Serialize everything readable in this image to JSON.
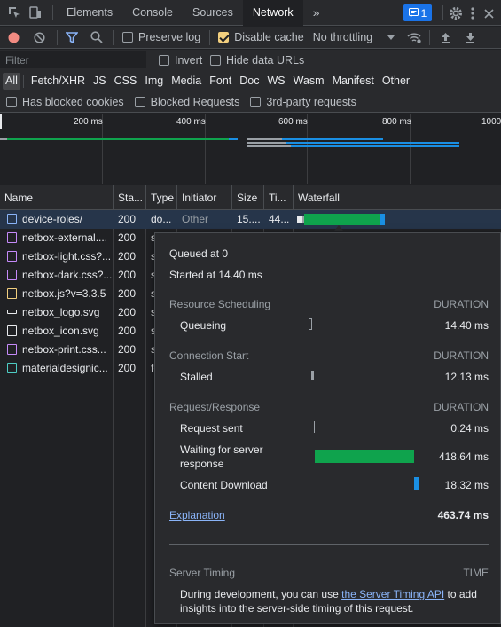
{
  "tabs": {
    "items": [
      "Elements",
      "Console",
      "Sources",
      "Network"
    ],
    "more": "»",
    "issues_count": "1"
  },
  "toolbar": {
    "preserve_log": "Preserve log",
    "disable_cache": "Disable cache",
    "throttling": "No throttling"
  },
  "filter": {
    "placeholder": "Filter",
    "invert": "Invert",
    "hide_data_urls": "Hide data URLs"
  },
  "types": [
    "All",
    "Fetch/XHR",
    "JS",
    "CSS",
    "Img",
    "Media",
    "Font",
    "Doc",
    "WS",
    "Wasm",
    "Manifest",
    "Other"
  ],
  "options": {
    "blocked_cookies": "Has blocked cookies",
    "blocked_requests": "Blocked Requests",
    "third_party": "3rd-party requests"
  },
  "overview": {
    "ticks": [
      "200 ms",
      "400 ms",
      "600 ms",
      "800 ms",
      "1000"
    ]
  },
  "table": {
    "headers": [
      "Name",
      "Sta...",
      "Type",
      "Initiator",
      "Size",
      "Ti...",
      "Waterfall"
    ],
    "rows": [
      {
        "name": "device-roles/",
        "status": "200",
        "type": "do...",
        "initiator": "Other",
        "size": "15....",
        "time": "44...",
        "kind": "doc"
      },
      {
        "name": "netbox-external....",
        "status": "200",
        "type": "s",
        "initiator": "",
        "size": "",
        "time": "",
        "kind": "css"
      },
      {
        "name": "netbox-light.css?...",
        "status": "200",
        "type": "s",
        "initiator": "",
        "size": "",
        "time": "",
        "kind": "css"
      },
      {
        "name": "netbox-dark.css?...",
        "status": "200",
        "type": "s",
        "initiator": "",
        "size": "",
        "time": "",
        "kind": "css"
      },
      {
        "name": "netbox.js?v=3.3.5",
        "status": "200",
        "type": "s",
        "initiator": "",
        "size": "",
        "time": "",
        "kind": "js"
      },
      {
        "name": "netbox_logo.svg",
        "status": "200",
        "type": "s",
        "initiator": "",
        "size": "",
        "time": "",
        "kind": "img"
      },
      {
        "name": "netbox_icon.svg",
        "status": "200",
        "type": "s",
        "initiator": "",
        "size": "",
        "time": "",
        "kind": "img"
      },
      {
        "name": "netbox-print.css...",
        "status": "200",
        "type": "s",
        "initiator": "",
        "size": "",
        "time": "",
        "kind": "css"
      },
      {
        "name": "materialdesignic...",
        "status": "200",
        "type": "fo",
        "initiator": "",
        "size": "",
        "time": "",
        "kind": "font"
      }
    ]
  },
  "timing": {
    "queued_at": "Queued at 0",
    "started_at": "Started at 14.40 ms",
    "resource_scheduling": "Resource Scheduling",
    "duration": "DURATION",
    "queueing": "Queueing",
    "queueing_val": "14.40 ms",
    "connection_start": "Connection Start",
    "stalled": "Stalled",
    "stalled_val": "12.13 ms",
    "request_response": "Request/Response",
    "request_sent": "Request sent",
    "request_sent_val": "0.24 ms",
    "waiting_line1": "Waiting for server",
    "waiting_line2": "response",
    "waiting_val": "418.64 ms",
    "content_download": "Content Download",
    "content_download_val": "18.32 ms",
    "explanation": "Explanation",
    "total": "463.74 ms",
    "server_timing": "Server Timing",
    "time": "TIME",
    "note_pre": "During development, you can use ",
    "note_link": "the Server Timing API",
    "note_post": " to add",
    "note_line2": "insights into the server-side timing of this request."
  },
  "colors": {
    "waiting": "#0fa34d",
    "download": "#1a8fe3",
    "record": "#f28b82",
    "accent": "#8ab4f8",
    "doc_icon": "#8ab4f8",
    "css_icon": "#c58af9",
    "js_icon": "#f2cf7e",
    "font_icon": "#4ecdc4"
  },
  "icons": [
    "inspect-icon",
    "device-toggle-icon",
    "issues-icon",
    "gear-icon",
    "kebab-icon",
    "close-icon",
    "record-icon",
    "clear-icon",
    "filter-icon",
    "search-icon",
    "wifi-settings-icon",
    "upload-icon",
    "download-icon",
    "dropdown-arrow-icon"
  ]
}
